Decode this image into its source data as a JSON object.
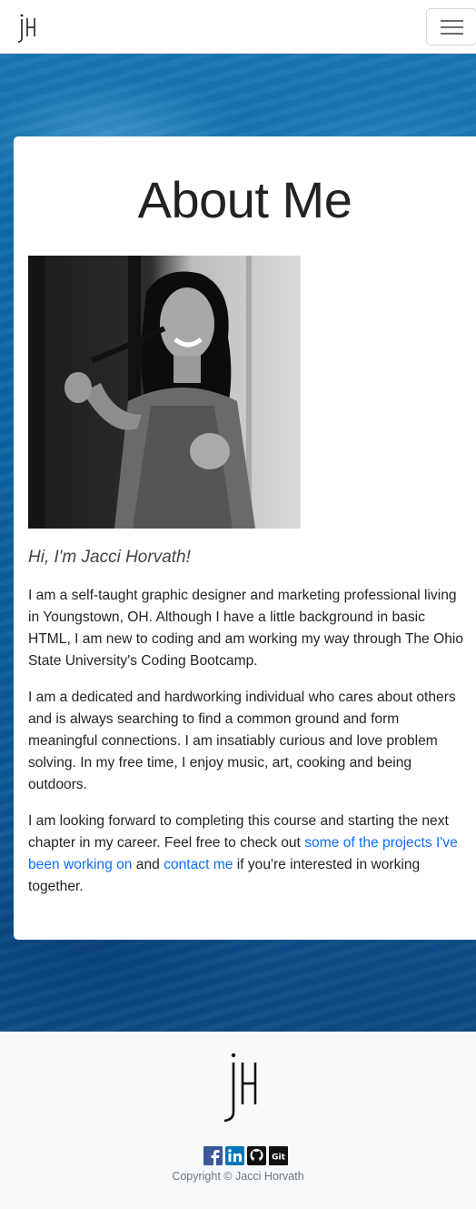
{
  "navbar": {
    "logo_icon": "jh-monogram-logo",
    "toggler_icon": "hamburger-menu-icon"
  },
  "about": {
    "title": "About Me",
    "greeting": "Hi, I'm Jacci Horvath!",
    "paragraph1": "I am a self-taught graphic designer and marketing professional living in Youngstown, OH. Although I have a little background in basic HTML, I am new to coding and am working my way through The Ohio State University's Coding Bootcamp.",
    "paragraph2": "I am a dedicated and hardworking individual who cares about others and is always searching to find a common ground and form meaningful connections. I am insatiably curious and love problem solving. In my free time, I enjoy music, art, cooking and being outdoors.",
    "paragraph3": {
      "before": "I am looking forward to completing this course and starting the next chapter in my career. Feel free to check out ",
      "link_projects": "some of the projects I've been working on",
      "middle": " and ",
      "link_contact": "contact me",
      "after": " if you're interested in working together."
    }
  },
  "footer": {
    "logo_icon": "jh-monogram-logo",
    "social": [
      {
        "name": "facebook-icon",
        "glyph": "f",
        "color": "#3b5998"
      },
      {
        "name": "linkedin-icon",
        "glyph": "in",
        "color": "#0077b5"
      },
      {
        "name": "github-icon",
        "glyph": "",
        "color": "#111111"
      },
      {
        "name": "git-icon",
        "glyph": "Git",
        "color": "#111111"
      }
    ],
    "copyright": "Copyright © Jacci Horvath"
  },
  "colors": {
    "link": "#0d6efd",
    "ocean": "#0b5f9c"
  }
}
